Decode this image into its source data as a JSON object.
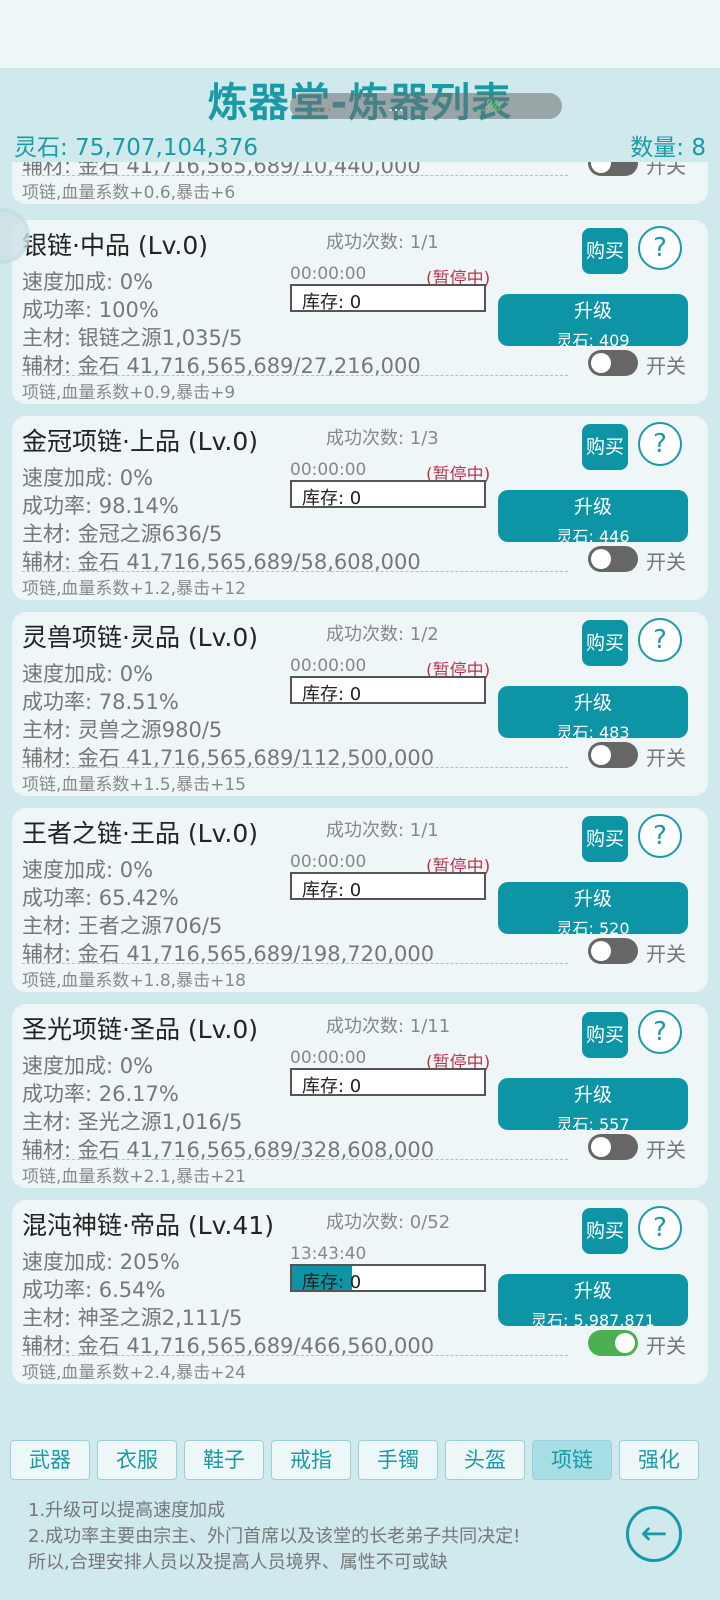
{
  "header": {
    "title": "炼器堂-炼器列表",
    "spirit_stone": "灵石: 75,707,104,376",
    "count": "数量: 8"
  },
  "overlay": {
    "left": "…",
    "mid": "…",
    "right": "…%"
  },
  "items": [
    {
      "name": "",
      "success": "",
      "speed": "",
      "rate": "",
      "main": "",
      "aux": "辅材: 金石 41,716,565,689/10,440,000",
      "bonus": "项链,血量系数+0.6,暴击+6",
      "timer": "",
      "paused": "",
      "stock": "",
      "stock_fill_pct": 0,
      "buy": "",
      "help": "",
      "upgrade": "",
      "upgrade_cost": "",
      "toggle_label": "开关",
      "toggle_on": false
    },
    {
      "name": "银链·中品 (Lv.0)",
      "success": "成功次数: 1/1",
      "speed": "速度加成: 0%",
      "rate": "成功率: 100%",
      "main": "主材: 银链之源1,035/5",
      "aux": "辅材: 金石 41,716,565,689/27,216,000",
      "bonus": "项链,血量系数+0.9,暴击+9",
      "timer": "00:00:00",
      "paused": "(暂停中)",
      "stock": "库存: 0",
      "stock_fill_pct": 0,
      "buy": "购买",
      "help": "?",
      "upgrade": "升级",
      "upgrade_cost": "灵石: 409",
      "toggle_label": "开关",
      "toggle_on": false
    },
    {
      "name": "金冠项链·上品 (Lv.0)",
      "success": "成功次数: 1/3",
      "speed": "速度加成: 0%",
      "rate": "成功率: 98.14%",
      "main": "主材: 金冠之源636/5",
      "aux": "辅材: 金石 41,716,565,689/58,608,000",
      "bonus": "项链,血量系数+1.2,暴击+12",
      "timer": "00:00:00",
      "paused": "(暂停中)",
      "stock": "库存: 0",
      "stock_fill_pct": 0,
      "buy": "购买",
      "help": "?",
      "upgrade": "升级",
      "upgrade_cost": "灵石: 446",
      "toggle_label": "开关",
      "toggle_on": false
    },
    {
      "name": "灵兽项链·灵品 (Lv.0)",
      "success": "成功次数: 1/2",
      "speed": "速度加成: 0%",
      "rate": "成功率: 78.51%",
      "main": "主材: 灵兽之源980/5",
      "aux": "辅材: 金石 41,716,565,689/112,500,000",
      "bonus": "项链,血量系数+1.5,暴击+15",
      "timer": "00:00:00",
      "paused": "(暂停中)",
      "stock": "库存: 0",
      "stock_fill_pct": 0,
      "buy": "购买",
      "help": "?",
      "upgrade": "升级",
      "upgrade_cost": "灵石: 483",
      "toggle_label": "开关",
      "toggle_on": false
    },
    {
      "name": "王者之链·王品 (Lv.0)",
      "success": "成功次数: 1/1",
      "speed": "速度加成: 0%",
      "rate": "成功率: 65.42%",
      "main": "主材: 王者之源706/5",
      "aux": "辅材: 金石 41,716,565,689/198,720,000",
      "bonus": "项链,血量系数+1.8,暴击+18",
      "timer": "00:00:00",
      "paused": "(暂停中)",
      "stock": "库存: 0",
      "stock_fill_pct": 0,
      "buy": "购买",
      "help": "?",
      "upgrade": "升级",
      "upgrade_cost": "灵石: 520",
      "toggle_label": "开关",
      "toggle_on": false
    },
    {
      "name": "圣光项链·圣品 (Lv.0)",
      "success": "成功次数: 1/11",
      "speed": "速度加成: 0%",
      "rate": "成功率: 26.17%",
      "main": "主材: 圣光之源1,016/5",
      "aux": "辅材: 金石 41,716,565,689/328,608,000",
      "bonus": "项链,血量系数+2.1,暴击+21",
      "timer": "00:00:00",
      "paused": "(暂停中)",
      "stock": "库存: 0",
      "stock_fill_pct": 0,
      "buy": "购买",
      "help": "?",
      "upgrade": "升级",
      "upgrade_cost": "灵石: 557",
      "toggle_label": "开关",
      "toggle_on": false
    },
    {
      "name": "混沌神链·帝品 (Lv.41)",
      "success": "成功次数: 0/52",
      "speed": "速度加成: 205%",
      "rate": "成功率: 6.54%",
      "main": "主材: 神圣之源2,111/5",
      "aux": "辅材: 金石 41,716,565,689/466,560,000",
      "bonus": "项链,血量系数+2.4,暴击+24",
      "timer": "13:43:40",
      "paused": "",
      "stock": "库存: 0",
      "stock_fill_pct": 31,
      "buy": "购买",
      "help": "?",
      "upgrade": "升级",
      "upgrade_cost": "灵石: 5,987,871",
      "toggle_label": "开关",
      "toggle_on": true
    }
  ],
  "tabs": [
    "武器",
    "衣服",
    "鞋子",
    "戒指",
    "手镯",
    "头盔",
    "项链",
    "强化"
  ],
  "active_tab": "项链",
  "notes": [
    "1.升级可以提高速度加成",
    "2.成功率主要由宗主、外门首席以及该堂的长老弟子共同决定!",
    "所以,合理安排人员以及提高人员境界、属性不可或缺"
  ],
  "back_icon": "back-arrow-icon",
  "colors": {
    "accent": "#0d95a6",
    "title": "#1a9aa6",
    "paused": "#c0334a",
    "toggle_on": "#4caf50",
    "toggle_off": "#666666",
    "background": "#cfe9ec"
  }
}
